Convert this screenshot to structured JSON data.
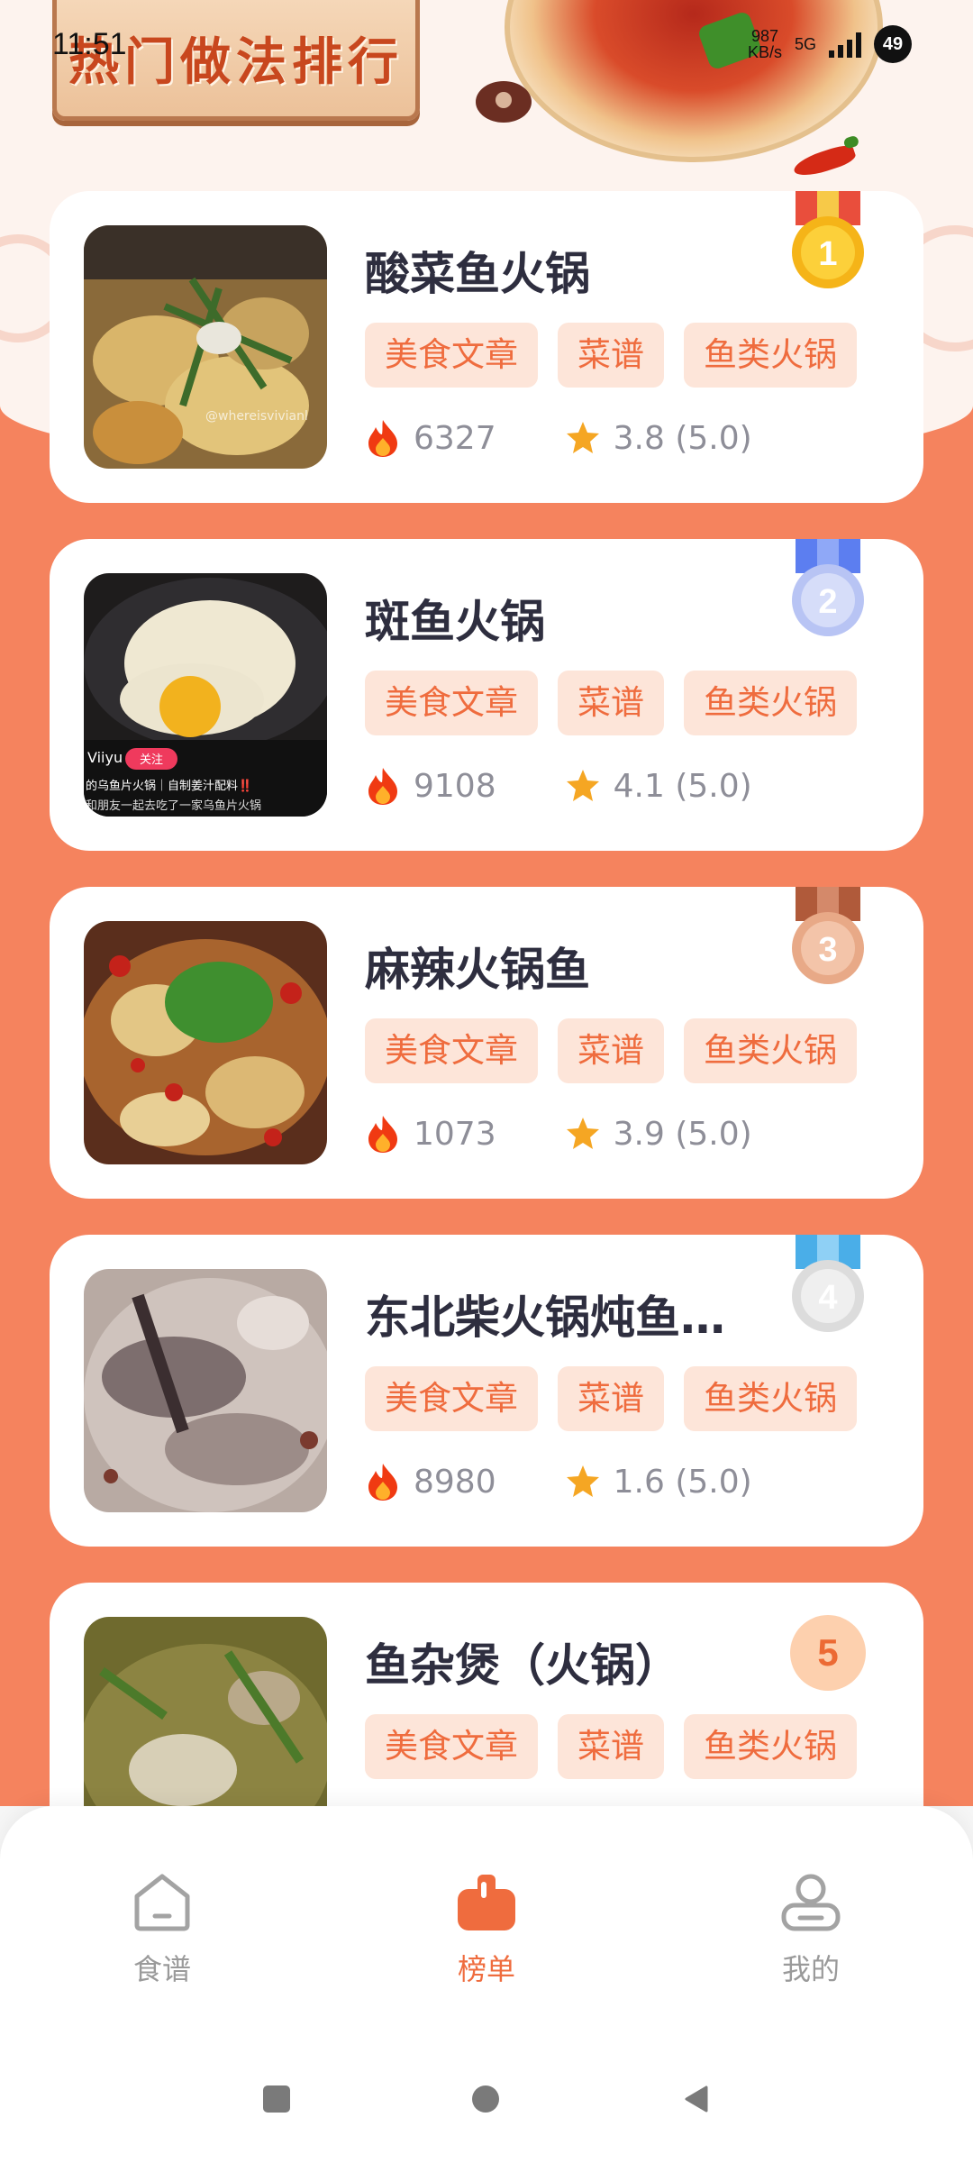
{
  "status_bar": {
    "time": "11:51",
    "net_speed": "987",
    "net_unit": "KB/s",
    "network_type": "5G",
    "battery": "49"
  },
  "header": {
    "title": "热门做法排行"
  },
  "items": [
    {
      "rank": "1",
      "rank_style": "gold-medal",
      "title": "酸菜鱼火锅",
      "tags": [
        "美食文章",
        "菜谱",
        "鱼类火锅"
      ],
      "heat": "6327",
      "rating": "3.8 (5.0)",
      "watermark": "@whereisvivianl"
    },
    {
      "rank": "2",
      "rank_style": "silver-blue-medal",
      "title": "斑鱼火锅",
      "tags": [
        "美食文章",
        "菜谱",
        "鱼类火锅"
      ],
      "heat": "9108",
      "rating": "4.1 (5.0)",
      "overlay_user": "Viiyu",
      "overlay_follow": "关注",
      "overlay_caption1": "的乌鱼片火锅｜自制姜汁配料‼️",
      "overlay_caption2": "和朋友一起去吃了一家乌鱼片火锅"
    },
    {
      "rank": "3",
      "rank_style": "bronze-medal",
      "title": "麻辣火锅鱼",
      "tags": [
        "美食文章",
        "菜谱",
        "鱼类火锅"
      ],
      "heat": "1073",
      "rating": "3.9 (5.0)"
    },
    {
      "rank": "4",
      "rank_style": "silver-medal",
      "title": "东北柴火锅炖鱼…",
      "tags": [
        "美食文章",
        "菜谱",
        "鱼类火锅"
      ],
      "heat": "8980",
      "rating": "1.6 (5.0)"
    },
    {
      "rank": "5",
      "rank_style": "number-badge",
      "title": "鱼杂煲（火锅）",
      "tags": [
        "美食文章",
        "菜谱",
        "鱼类火锅"
      ],
      "heat": "",
      "rating": ""
    }
  ],
  "bottom_nav": [
    {
      "label": "食谱",
      "icon": "home-icon",
      "active": false
    },
    {
      "label": "榜单",
      "icon": "ranking-icon",
      "active": true
    },
    {
      "label": "我的",
      "icon": "profile-icon",
      "active": false
    }
  ],
  "colors": {
    "accent": "#ef6c3e",
    "page_bg": "#f5835e",
    "tag_bg": "#fde5d9",
    "gold": "#f5b418",
    "silver_blue": "#b8c4f4",
    "bronze": "#e8a987",
    "silver": "#dcdcdc"
  }
}
